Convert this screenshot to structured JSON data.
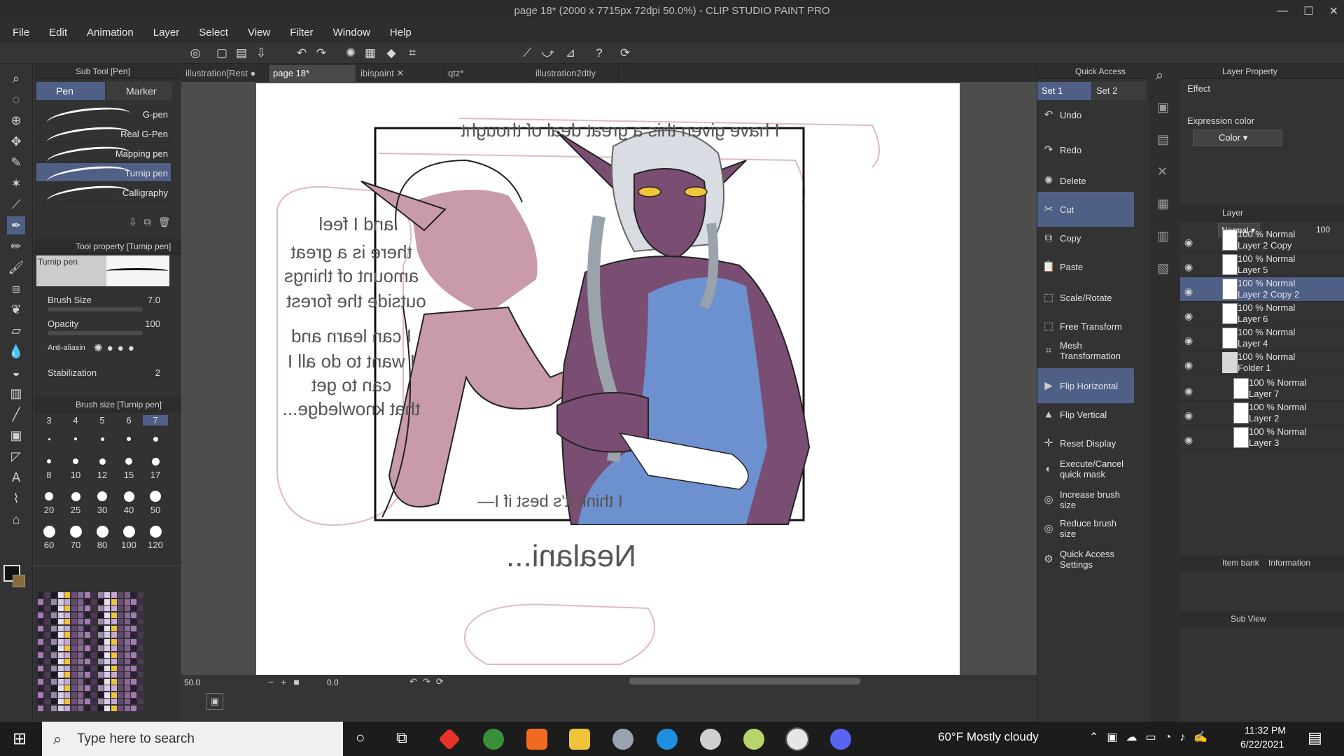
{
  "window": {
    "title": "page 18* (2000 x 7715px 72dpi 50.0%)  - CLIP STUDIO PAINT PRO"
  },
  "menu": [
    "File",
    "Edit",
    "Animation",
    "Layer",
    "Select",
    "View",
    "Filter",
    "Window",
    "Help"
  ],
  "subtool": {
    "header": "Sub Tool [Pen]",
    "tabs": [
      "Pen",
      "Marker"
    ],
    "brushes": [
      "G-pen",
      "Real G-Pen",
      "Mapping pen",
      "Turnip pen",
      "Calligraphy"
    ],
    "selected_index": 3
  },
  "toolprop": {
    "header": "Tool property [Turnip pen]",
    "preview_label": "Turnip pen",
    "brush_size_label": "Brush Size",
    "brush_size": "7.0",
    "opacity_label": "Opacity",
    "opacity": "100",
    "antialias_label": "Anti-aliasin",
    "stabilization_label": "Stabilization",
    "stabilization": "2"
  },
  "brushsize": {
    "header": "Brush size [Turnip pen]",
    "sizes": [
      "3",
      "4",
      "5",
      "6",
      "7",
      "8",
      "10",
      "12",
      "15",
      "17",
      "20",
      "25",
      "30",
      "40",
      "50",
      "60",
      "70",
      "80",
      "100",
      "120"
    ]
  },
  "tabs": [
    "illustration[Rest",
    "page 18*",
    "ibispaint",
    "qtz*",
    "illustration2dtiy"
  ],
  "canvas": {
    "zoom": "50.0",
    "angle": "0.0",
    "text": {
      "top": "I have given this a great deal of thought",
      "feel": "and I feel",
      "great": "there is a great",
      "amount": "amount of things",
      "forest": "outside the forest",
      "learn": "I can learn and",
      "want": "I want to do all I",
      "get": "can to get",
      "knowledge": "that knowledge...",
      "best": "I think it's best if I—",
      "name": "Nealani..."
    }
  },
  "quick": {
    "header": "Quick Access",
    "sets": [
      "Set 1",
      "Set 2"
    ],
    "items": [
      "Undo",
      "Redo",
      "Delete",
      "Cut",
      "Copy",
      "Paste",
      "Scale/Rotate",
      "Free Transform",
      "Mesh Transformation",
      "Flip Horizontal",
      "Flip Vertical",
      "Reset Display",
      "Execute/Cancel quick mask",
      "Increase brush size",
      "Reduce brush size",
      "Quick Access Settings"
    ]
  },
  "layerprop": {
    "header": "Layer Property",
    "effect_label": "Effect",
    "expression_label": "Expression color",
    "expression_value": "Color"
  },
  "layer": {
    "header": "Layer",
    "blend": "Normal",
    "opacity": "100",
    "rows": [
      {
        "mode": "100 % Normal",
        "name": "Layer 2 Copy"
      },
      {
        "mode": "100 % Normal",
        "name": "Layer 5"
      },
      {
        "mode": "100 % Normal",
        "name": "Layer 2 Copy 2"
      },
      {
        "mode": "100 % Normal",
        "name": "Layer 6"
      },
      {
        "mode": "100 % Normal",
        "name": "Layer 4"
      },
      {
        "mode": "100 % Normal",
        "name": "Folder 1"
      },
      {
        "mode": "100 % Normal",
        "name": "Layer 7"
      },
      {
        "mode": "100 % Normal",
        "name": "Layer 2"
      },
      {
        "mode": "100 % Normal",
        "name": "Layer 3"
      }
    ],
    "selected_index": 2
  },
  "itembank": {
    "tab1": "Item bank",
    "tab2": "Information"
  },
  "subview": {
    "label": "Sub View"
  },
  "taskbar": {
    "search_placeholder": "Type here to search",
    "weather": "60°F  Mostly cloudy",
    "time": "11:32 PM",
    "date": "6/22/2021"
  },
  "colors": {
    "accent": "#4f5f86",
    "skin_elf": "#7a4e72",
    "skin_girl": "#c99aa8",
    "dress": "#6d94d3"
  }
}
